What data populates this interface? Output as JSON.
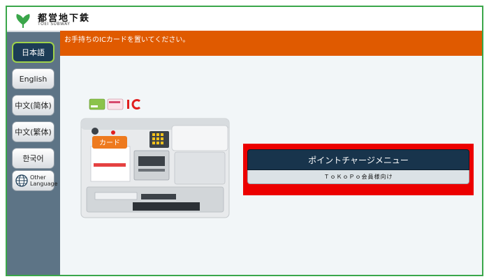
{
  "header": {
    "logo_text_ja": "都営地下鉄",
    "logo_text_en": "TOEI SUBWAY",
    "logo_icon": "toei-ginkgo-leaf-icon",
    "brand_color": "#3aa64a"
  },
  "sidebar": {
    "languages": [
      {
        "label": "日本語",
        "active": true
      },
      {
        "label": "English",
        "active": false
      },
      {
        "label": "中文(简体)",
        "active": false
      },
      {
        "label": "中文(繁体)",
        "active": false
      },
      {
        "label": "한국어",
        "active": false
      }
    ],
    "other": {
      "label_line1": "Other",
      "label_line2": "Language",
      "icon": "globe-icon"
    },
    "bg_color": "#5d7486"
  },
  "instruction": {
    "text": "お手持ちのICカードを置いてください。",
    "bg_color": "#e05a00"
  },
  "illustration": {
    "card_slot_label": "カード",
    "icons": [
      "suica-card-icon",
      "pasmo-card-icon",
      "ic-logo-icon"
    ]
  },
  "charge_menu": {
    "title": "ポイントチャージメニュー",
    "subtitle": "ＴｏＫｏＰｏ会員様向け",
    "highlight_color": "#ec0000"
  }
}
